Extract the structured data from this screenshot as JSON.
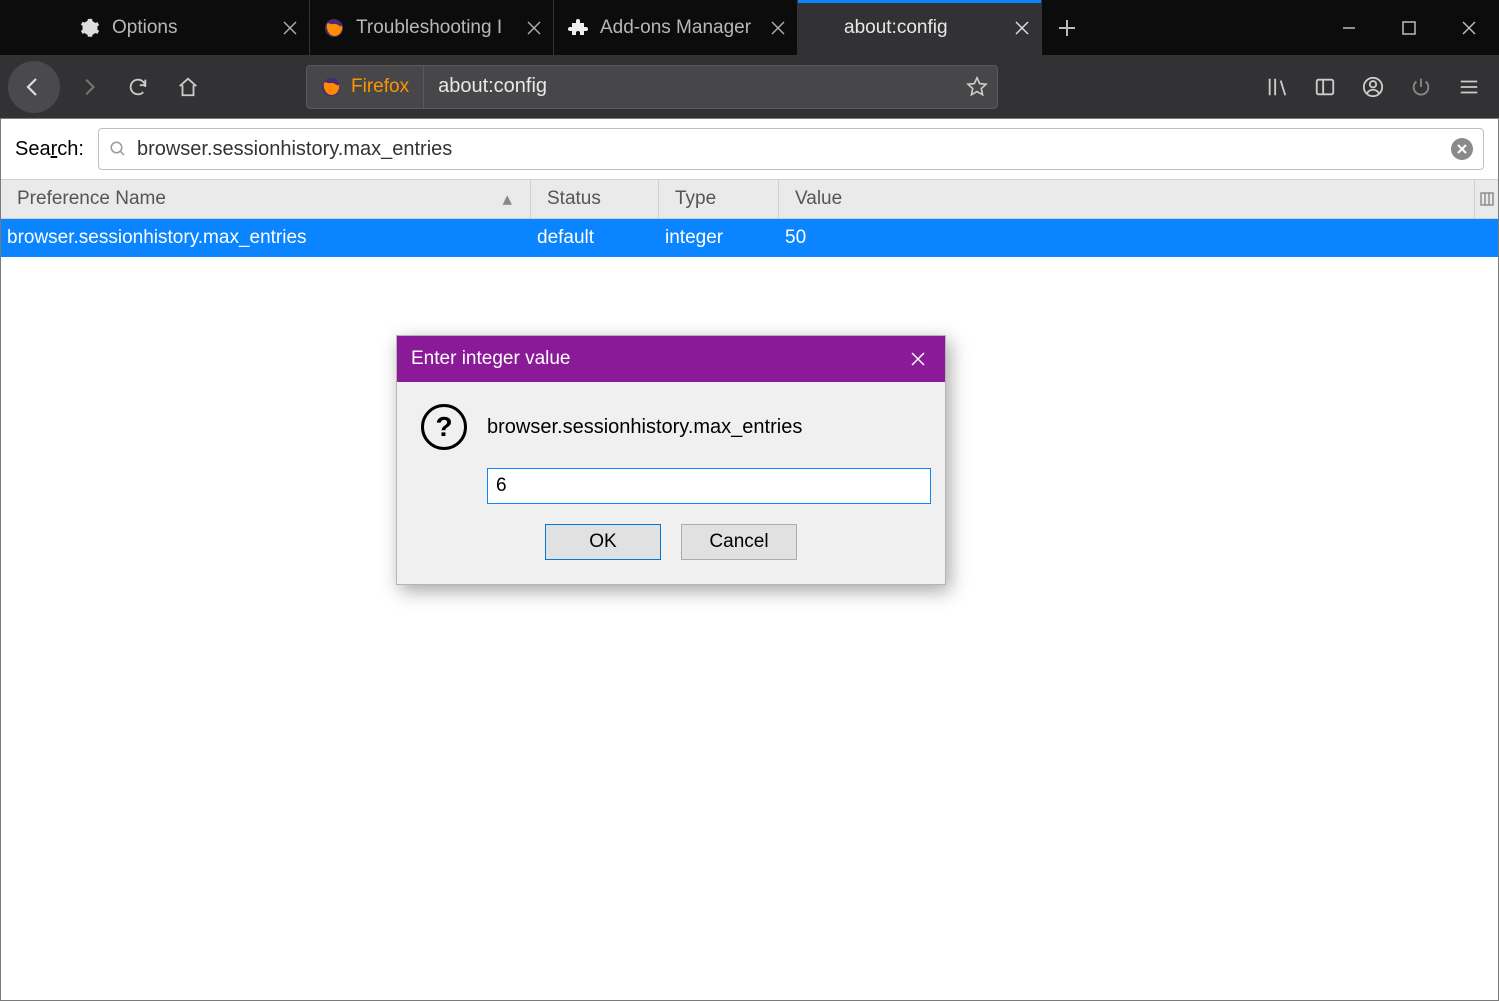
{
  "tabs": [
    {
      "label": "Options",
      "icon": "gear"
    },
    {
      "label": "Troubleshooting I",
      "icon": "firefox"
    },
    {
      "label": "Add-ons Manager",
      "icon": "puzzle"
    },
    {
      "label": "about:config",
      "icon": "none",
      "active": true
    }
  ],
  "url": {
    "brand": "Firefox",
    "address": "about:config"
  },
  "search": {
    "label_pre": "Sea",
    "label_u": "r",
    "label_post": "ch:",
    "value": "browser.sessionhistory.max_entries"
  },
  "columns": {
    "name": "Preference Name",
    "status": "Status",
    "type": "Type",
    "value": "Value"
  },
  "row": {
    "name": "browser.sessionhistory.max_entries",
    "status": "default",
    "type": "integer",
    "value": "50"
  },
  "dialog": {
    "title": "Enter integer value",
    "pref": "browser.sessionhistory.max_entries",
    "input": "6",
    "ok": "OK",
    "cancel": "Cancel"
  }
}
